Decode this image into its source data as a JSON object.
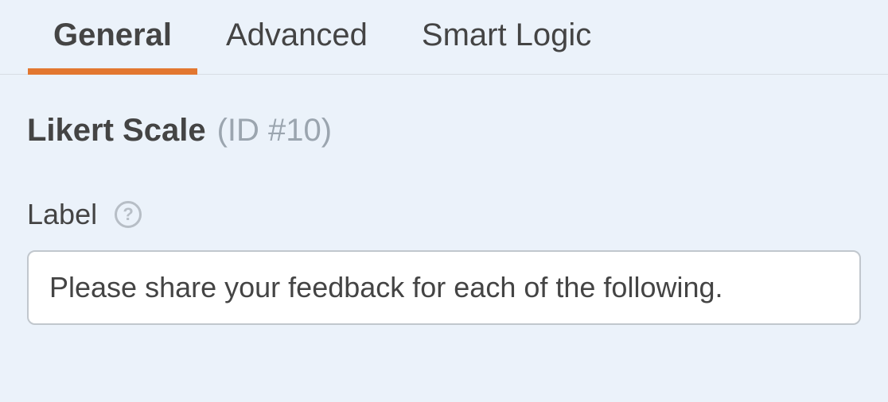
{
  "tabs": [
    {
      "label": "General",
      "active": true
    },
    {
      "label": "Advanced",
      "active": false
    },
    {
      "label": "Smart Logic",
      "active": false
    }
  ],
  "field_type_title": "Likert Scale",
  "field_id_label": "(ID #10)",
  "label_field": {
    "caption": "Label",
    "value": "Please share your feedback for each of the following."
  },
  "colors": {
    "accent": "#e27730",
    "bg": "#ebf2fa",
    "text": "#444",
    "muted": "#9ba5af",
    "border": "#c1c7cd"
  }
}
